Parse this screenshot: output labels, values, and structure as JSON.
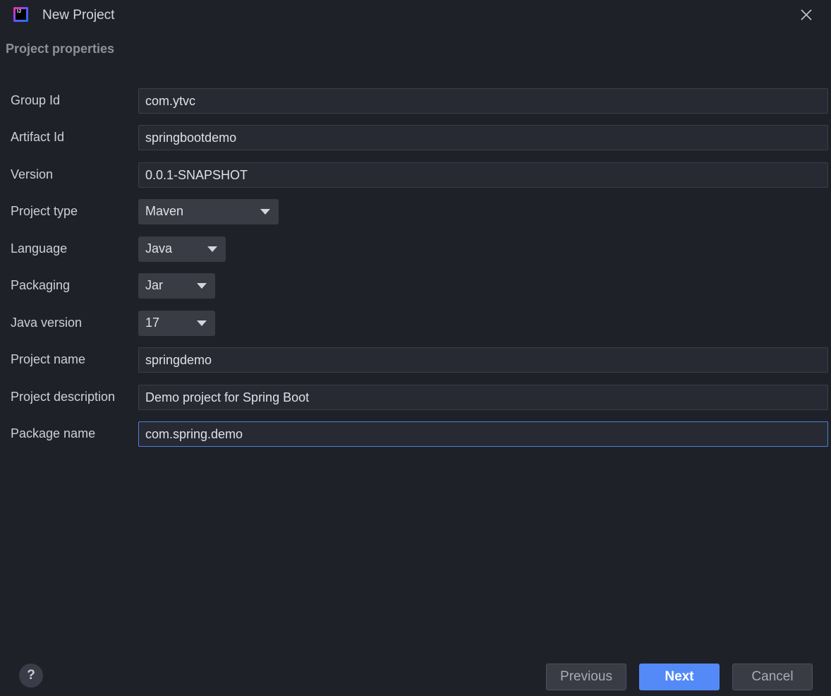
{
  "window": {
    "title": "New Project",
    "close_icon": "close-icon",
    "app_icon": "intellij-idea-icon",
    "app_icon_text": "IJ"
  },
  "section": {
    "title": "Project properties"
  },
  "form": {
    "group_id": {
      "label": "Group Id",
      "value": "com.ytvc"
    },
    "artifact_id": {
      "label": "Artifact Id",
      "value": "springbootdemo"
    },
    "version": {
      "label": "Version",
      "value": "0.0.1-SNAPSHOT"
    },
    "project_type": {
      "label": "Project type",
      "value": "Maven"
    },
    "language": {
      "label": "Language",
      "value": "Java"
    },
    "packaging": {
      "label": "Packaging",
      "value": "Jar"
    },
    "java_version": {
      "label": "Java version",
      "value": "17"
    },
    "project_name": {
      "label": "Project name",
      "value": "springdemo"
    },
    "project_description": {
      "label": "Project description",
      "value": "Demo project for Spring Boot"
    },
    "package_name": {
      "label": "Package name",
      "value": "com.spring.demo"
    }
  },
  "footer": {
    "help_label": "?",
    "previous_label": "Previous",
    "next_label": "Next",
    "cancel_label": "Cancel"
  },
  "colors": {
    "background": "#1f2129",
    "input_background": "#272a33",
    "focus_border": "#4f7fd6",
    "primary_button": "#548af7"
  }
}
